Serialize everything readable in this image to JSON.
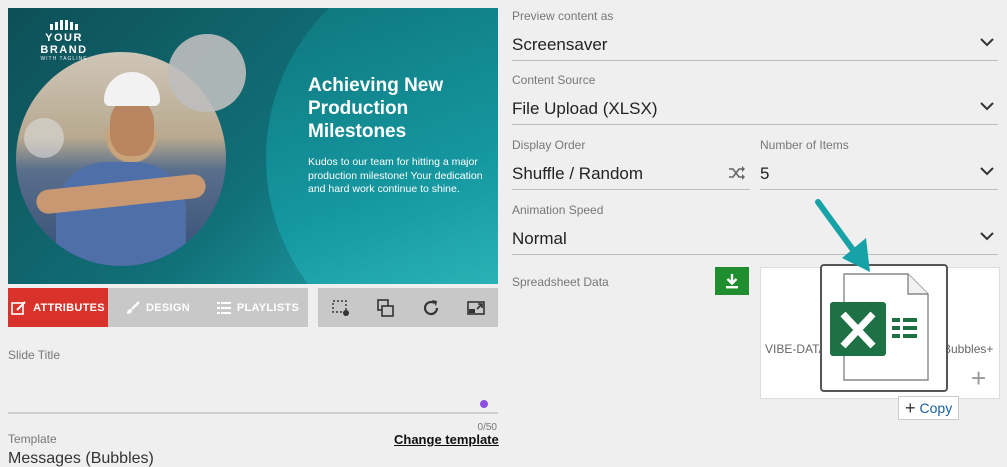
{
  "preview": {
    "brand_name": "YOUR BRAND",
    "brand_tagline": "WITH TAGLINE",
    "headline": "Achieving New Production Milestones",
    "body": "Kudos to our team for hitting a major production milestone! Your dedication and hard work continue to shine."
  },
  "tabs": [
    {
      "label": "ATTRIBUTES",
      "icon": "edit-icon",
      "active": true
    },
    {
      "label": "DESIGN",
      "icon": "brush-icon",
      "active": false
    },
    {
      "label": "PLAYLISTS",
      "icon": "list-icon",
      "active": false
    }
  ],
  "toolbar": {
    "tools": [
      "crop-settings-icon",
      "layers-icon",
      "refresh-icon",
      "resize-icon"
    ]
  },
  "slide_title": {
    "label": "Slide Title",
    "value": "",
    "counter": "0/50"
  },
  "template": {
    "label": "Template",
    "change_link": "Change template",
    "value": "Messages (Bubbles)"
  },
  "form": {
    "preview_content": {
      "label": "Preview content as",
      "value": "Screensaver"
    },
    "content_source": {
      "label": "Content Source",
      "value": "File Upload (XLSX)"
    },
    "display_order": {
      "label": "Display Order",
      "value": "Shuffle / Random"
    },
    "number_of_items": {
      "label": "Number of Items",
      "value": "5"
    },
    "animation_speed": {
      "label": "Animation Speed",
      "value": "Normal"
    }
  },
  "spreadsheet": {
    "label": "Spreadsheet Data",
    "file_left_text": "VIBE-DATA",
    "file_right_text": "Bubbles+",
    "copy_tooltip": "Copy"
  },
  "colors": {
    "accent_red": "#d9322b",
    "download_green": "#1e8e2f",
    "excel_green": "#1e7145",
    "arrow_teal": "#17a2a8"
  }
}
